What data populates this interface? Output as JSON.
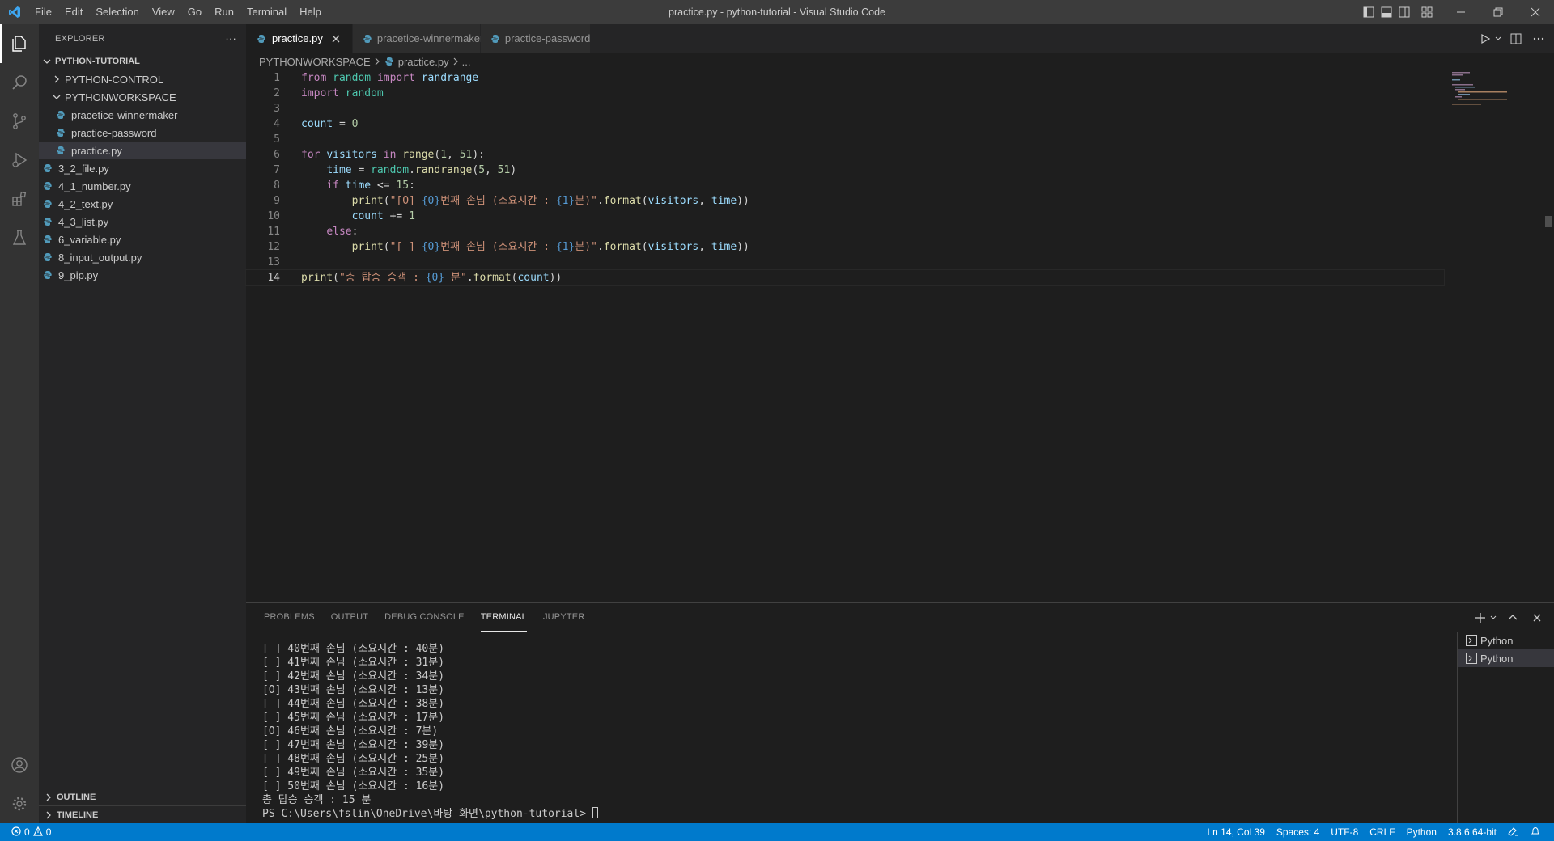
{
  "title_bar": {
    "menu": [
      "File",
      "Edit",
      "Selection",
      "View",
      "Go",
      "Run",
      "Terminal",
      "Help"
    ],
    "window_title": "practice.py - python-tutorial - Visual Studio Code"
  },
  "explorer": {
    "header": "EXPLORER",
    "more": "···",
    "root": "PYTHON-TUTORIAL",
    "items": [
      {
        "label": "PYTHON-CONTROL",
        "type": "folder",
        "expanded": false,
        "depth": 1
      },
      {
        "label": "PYTHONWORKSPACE",
        "type": "folder",
        "expanded": true,
        "depth": 1
      },
      {
        "label": "pracetice-winnermaker",
        "type": "file",
        "depth": 2
      },
      {
        "label": "practice-password",
        "type": "file",
        "depth": 2
      },
      {
        "label": "practice.py",
        "type": "file",
        "depth": 2,
        "selected": true
      },
      {
        "label": "3_2_file.py",
        "type": "file",
        "depth": 1
      },
      {
        "label": "4_1_number.py",
        "type": "file",
        "depth": 1
      },
      {
        "label": "4_2_text.py",
        "type": "file",
        "depth": 1
      },
      {
        "label": "4_3_list.py",
        "type": "file",
        "depth": 1
      },
      {
        "label": "6_variable.py",
        "type": "file",
        "depth": 1
      },
      {
        "label": "8_input_output.py",
        "type": "file",
        "depth": 1
      },
      {
        "label": "9_pip.py",
        "type": "file",
        "depth": 1
      }
    ],
    "outline": "OUTLINE",
    "timeline": "TIMELINE"
  },
  "tabs": [
    {
      "label": "practice.py",
      "active": true
    },
    {
      "label": "pracetice-winnermaker",
      "active": false
    },
    {
      "label": "practice-password",
      "active": false
    }
  ],
  "breadcrumb": {
    "folder": "PYTHONWORKSPACE",
    "file": "practice.py",
    "rest": "..."
  },
  "code_lines": [
    {
      "n": "1",
      "tokens": [
        [
          "from",
          "kw"
        ],
        [
          " ",
          "plain"
        ],
        [
          "random",
          "mod"
        ],
        [
          " ",
          "plain"
        ],
        [
          "import",
          "kw"
        ],
        [
          " ",
          "plain"
        ],
        [
          "randrange",
          "var"
        ]
      ]
    },
    {
      "n": "2",
      "tokens": [
        [
          "import",
          "kw"
        ],
        [
          " ",
          "plain"
        ],
        [
          "random",
          "mod"
        ]
      ]
    },
    {
      "n": "3",
      "tokens": []
    },
    {
      "n": "4",
      "tokens": [
        [
          "count",
          "var"
        ],
        [
          " = ",
          "plain"
        ],
        [
          "0",
          "num"
        ]
      ]
    },
    {
      "n": "5",
      "tokens": []
    },
    {
      "n": "6",
      "tokens": [
        [
          "for",
          "kw"
        ],
        [
          " ",
          "plain"
        ],
        [
          "visitors",
          "var"
        ],
        [
          " ",
          "plain"
        ],
        [
          "in",
          "kw"
        ],
        [
          " ",
          "plain"
        ],
        [
          "range",
          "fn"
        ],
        [
          "(",
          "plain"
        ],
        [
          "1",
          "num"
        ],
        [
          ", ",
          "plain"
        ],
        [
          "51",
          "num"
        ],
        [
          "):",
          "plain"
        ]
      ]
    },
    {
      "n": "7",
      "tokens": [
        [
          "    ",
          "plain"
        ],
        [
          "time",
          "var"
        ],
        [
          " = ",
          "plain"
        ],
        [
          "random",
          "mod"
        ],
        [
          ".",
          "plain"
        ],
        [
          "randrange",
          "fn"
        ],
        [
          "(",
          "plain"
        ],
        [
          "5",
          "num"
        ],
        [
          ", ",
          "plain"
        ],
        [
          "51",
          "num"
        ],
        [
          ")",
          "plain"
        ]
      ]
    },
    {
      "n": "8",
      "tokens": [
        [
          "    ",
          "plain"
        ],
        [
          "if",
          "kw"
        ],
        [
          " ",
          "plain"
        ],
        [
          "time",
          "var"
        ],
        [
          " <= ",
          "plain"
        ],
        [
          "15",
          "num"
        ],
        [
          ":",
          "plain"
        ]
      ]
    },
    {
      "n": "9",
      "tokens": [
        [
          "        ",
          "plain"
        ],
        [
          "print",
          "fn"
        ],
        [
          "(",
          "plain"
        ],
        [
          "\"[O] ",
          "str"
        ],
        [
          "{0}",
          "esc"
        ],
        [
          "번째 손님 (소요시간 : ",
          "str"
        ],
        [
          "{1}",
          "esc"
        ],
        [
          "분)\"",
          "str"
        ],
        [
          ".",
          "plain"
        ],
        [
          "format",
          "fn"
        ],
        [
          "(",
          "plain"
        ],
        [
          "visitors",
          "var"
        ],
        [
          ", ",
          "plain"
        ],
        [
          "time",
          "var"
        ],
        [
          "))",
          "plain"
        ]
      ]
    },
    {
      "n": "10",
      "tokens": [
        [
          "        ",
          "plain"
        ],
        [
          "count",
          "var"
        ],
        [
          " += ",
          "plain"
        ],
        [
          "1",
          "num"
        ]
      ]
    },
    {
      "n": "11",
      "tokens": [
        [
          "    ",
          "plain"
        ],
        [
          "else",
          "kw"
        ],
        [
          ":",
          "plain"
        ]
      ]
    },
    {
      "n": "12",
      "tokens": [
        [
          "        ",
          "plain"
        ],
        [
          "print",
          "fn"
        ],
        [
          "(",
          "plain"
        ],
        [
          "\"[ ] ",
          "str"
        ],
        [
          "{0}",
          "esc"
        ],
        [
          "번째 손님 (소요시간 : ",
          "str"
        ],
        [
          "{1}",
          "esc"
        ],
        [
          "분)\"",
          "str"
        ],
        [
          ".",
          "plain"
        ],
        [
          "format",
          "fn"
        ],
        [
          "(",
          "plain"
        ],
        [
          "visitors",
          "var"
        ],
        [
          ", ",
          "plain"
        ],
        [
          "time",
          "var"
        ],
        [
          "))",
          "plain"
        ]
      ]
    },
    {
      "n": "13",
      "tokens": []
    },
    {
      "n": "14",
      "tokens": [
        [
          "print",
          "fn"
        ],
        [
          "(",
          "plain"
        ],
        [
          "\"총 탑승 승객 : ",
          "str"
        ],
        [
          "{0}",
          "esc"
        ],
        [
          " 분\"",
          "str"
        ],
        [
          ".",
          "plain"
        ],
        [
          "format",
          "fn"
        ],
        [
          "(",
          "plain"
        ],
        [
          "count",
          "var"
        ],
        [
          "))",
          "plain"
        ]
      ],
      "current": true
    }
  ],
  "panel": {
    "tabs": [
      {
        "label": "PROBLEMS",
        "active": false
      },
      {
        "label": "OUTPUT",
        "active": false
      },
      {
        "label": "DEBUG CONSOLE",
        "active": false
      },
      {
        "label": "TERMINAL",
        "active": true
      },
      {
        "label": "JUPYTER",
        "active": false
      }
    ],
    "terminal_lines": [
      "[ ] 40번째 손님 (소요시간 : 40분)",
      "[ ] 41번째 손님 (소요시간 : 31분)",
      "[ ] 42번째 손님 (소요시간 : 34분)",
      "[O] 43번째 손님 (소요시간 : 13분)",
      "[ ] 44번째 손님 (소요시간 : 38분)",
      "[ ] 45번째 손님 (소요시간 : 17분)",
      "[O] 46번째 손님 (소요시간 : 7분)",
      "[ ] 47번째 손님 (소요시간 : 39분)",
      "[ ] 48번째 손님 (소요시간 : 25분)",
      "[ ] 49번째 손님 (소요시간 : 35분)",
      "[ ] 50번째 손님 (소요시간 : 16분)",
      "총 탑승 승객 : 15 분"
    ],
    "prompt": "PS C:\\Users\\fslin\\OneDrive\\바탕 화면\\python-tutorial> ",
    "terminal_list": [
      {
        "label": "Python",
        "selected": false
      },
      {
        "label": "Python",
        "selected": true
      }
    ]
  },
  "status_bar": {
    "errors": "0",
    "warnings": "0",
    "position": "Ln 14, Col 39",
    "spaces": "Spaces: 4",
    "encoding": "UTF-8",
    "eol": "CRLF",
    "language": "Python",
    "interpreter": "3.8.6 64-bit"
  },
  "colors": {
    "accent": "#007acc",
    "titlebar": "#3c3c3c",
    "activitybar": "#333333",
    "sidebar": "#252526",
    "editor": "#1e1e1e",
    "python_icon": "#519aba"
  }
}
